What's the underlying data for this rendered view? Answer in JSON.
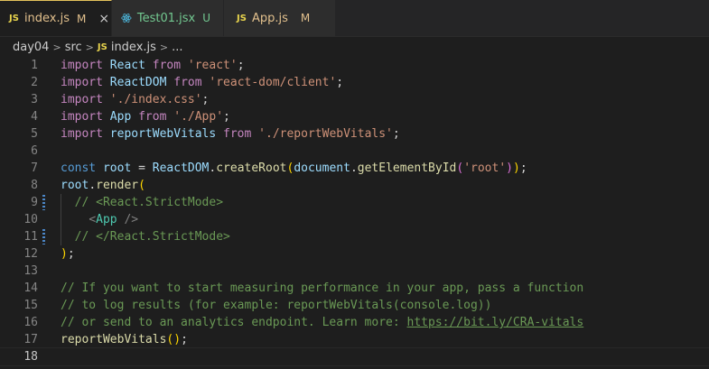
{
  "tabs": [
    {
      "icon": "JS",
      "name": "index.js",
      "badge": "M",
      "close": "×"
    },
    {
      "name": "Test01.jsx",
      "badge": "U"
    },
    {
      "icon": "JS",
      "name": "App.js",
      "badge": "M"
    }
  ],
  "breadcrumb": {
    "folder1": "day04",
    "folder2": "src",
    "file_icon": "JS",
    "file": "index.js",
    "more": "..."
  },
  "line_numbers": [
    "1",
    "2",
    "3",
    "4",
    "5",
    "6",
    "7",
    "8",
    "9",
    "10",
    "11",
    "12",
    "13",
    "14",
    "15",
    "16",
    "17",
    "18"
  ],
  "code": {
    "l1": {
      "k": "import",
      "n": "React",
      "f": "from",
      "s": "'react'",
      "e": ";"
    },
    "l2": {
      "k": "import",
      "n": "ReactDOM",
      "f": "from",
      "s": "'react-dom/client'",
      "e": ";"
    },
    "l3": {
      "k": "import",
      "s": "'./index.css'",
      "e": ";"
    },
    "l4": {
      "k": "import",
      "n": "App",
      "f": "from",
      "s": "'./App'",
      "e": ";"
    },
    "l5": {
      "k": "import",
      "n": "reportWebVitals",
      "f": "from",
      "s": "'./reportWebVitals'",
      "e": ";"
    },
    "l7": {
      "c": "const",
      "v": "root",
      "eq": " = ",
      "o": "ReactDOM",
      "d": ".",
      "m": "createRoot",
      "p1": "(",
      "doc": "document",
      "d2": ".",
      "m2": "getElementById",
      "p2": "(",
      "s": "'root'",
      "p3": ")",
      "p4": ")",
      "e": ";"
    },
    "l8": {
      "v": "root",
      "d": ".",
      "m": "render",
      "p": "("
    },
    "l9": {
      "t": "// <React.StrictMode>"
    },
    "l10": {
      "lt": "<",
      "tag": "App",
      "gt": " />"
    },
    "l11": {
      "t": "// </React.StrictMode>"
    },
    "l12": {
      "p": ")",
      "e": ";"
    },
    "l14": {
      "t": "// If you want to start measuring performance in your app, pass a function"
    },
    "l15": {
      "t": "// to log results (for example: reportWebVitals(console.log))"
    },
    "l16": {
      "t": "// or send to an analytics endpoint. Learn more: ",
      "url": "https://bit.ly/CRA-vitals"
    },
    "l17": {
      "m": "reportWebVitals",
      "p": "()",
      "e": ";"
    }
  }
}
